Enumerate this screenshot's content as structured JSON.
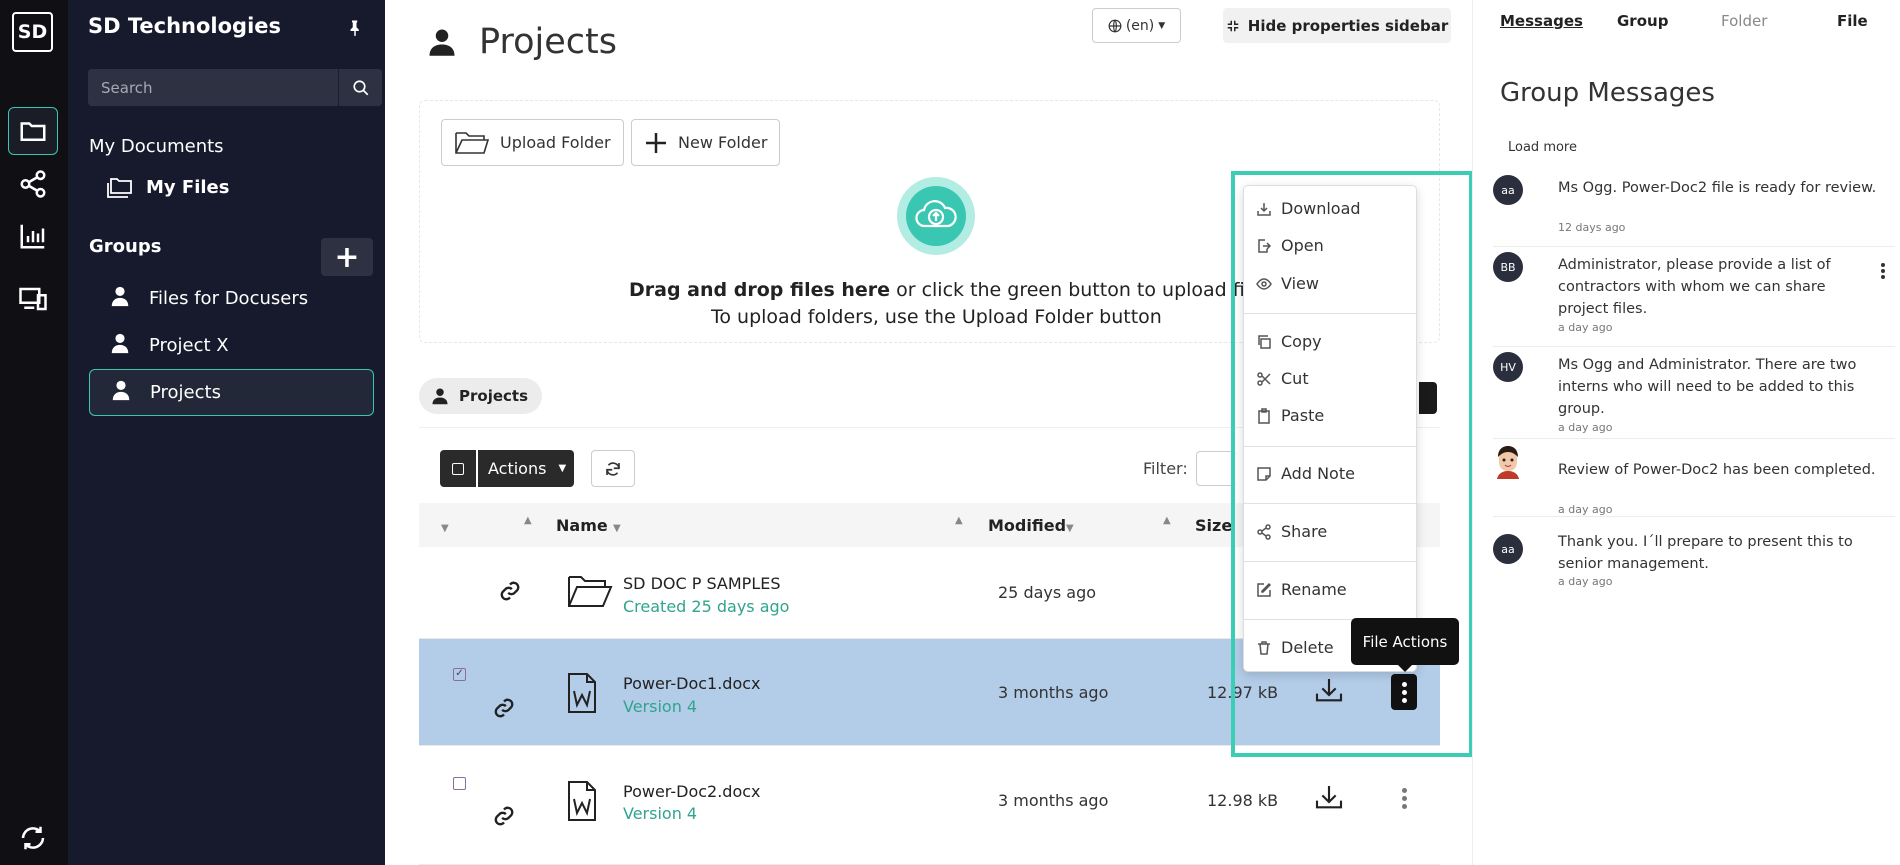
{
  "rail": {
    "logo": "SD"
  },
  "sidebar": {
    "brand": "SD Technologies",
    "search_placeholder": "Search",
    "my_documents": "My Documents",
    "my_files": "My Files",
    "groups_title": "Groups",
    "add_group": "+",
    "groups": [
      {
        "label": "Files for Docusers"
      },
      {
        "label": "Project X"
      },
      {
        "label": "Projects"
      }
    ]
  },
  "header": {
    "title": "Projects",
    "language": "(en)",
    "hide_sidebar": "Hide properties sidebar"
  },
  "upload": {
    "upload_folder": "Upload Folder",
    "new_folder": "New Folder",
    "drag_bold": "Drag and drop files here",
    "drag_rest": " or click the green button to upload files",
    "folder_hint": "To upload folders, use the Upload Folder button"
  },
  "breadcrumb": {
    "label": "Projects"
  },
  "toolbar": {
    "actions": "Actions",
    "filter_label": "Filter:"
  },
  "table": {
    "columns": {
      "name": "Name",
      "modified": "Modified",
      "size": "Size"
    },
    "rows": [
      {
        "name": "SD DOC P SAMPLES",
        "sub": "Created 25 days ago",
        "modified": "25 days ago",
        "size": "",
        "selected": false
      },
      {
        "name": "Power-Doc1.docx",
        "sub": "Version 4",
        "modified": "3 months ago",
        "size": "12.97 kB",
        "selected": true
      },
      {
        "name": "Power-Doc2.docx",
        "sub": "Version 4",
        "modified": "3 months ago",
        "size": "12.98 kB",
        "selected": false
      }
    ]
  },
  "context_menu": {
    "items": [
      {
        "label": "Download",
        "icon": "download-icon"
      },
      {
        "label": "Open",
        "icon": "open-icon"
      },
      {
        "label": "View",
        "icon": "eye-icon"
      },
      {
        "label": "Copy",
        "icon": "copy-icon"
      },
      {
        "label": "Cut",
        "icon": "scissors-icon"
      },
      {
        "label": "Paste",
        "icon": "clipboard-icon"
      },
      {
        "label": "Add Note",
        "icon": "note-icon"
      },
      {
        "label": "Share",
        "icon": "share-icon"
      },
      {
        "label": "Rename",
        "icon": "edit-icon"
      },
      {
        "label": "Delete",
        "icon": "trash-icon"
      }
    ],
    "tooltip": "File Actions"
  },
  "right_panel": {
    "tabs": [
      "Messages",
      "Group",
      "Folder",
      "File"
    ],
    "heading": "Group Messages",
    "load_more": "Load more",
    "messages": [
      {
        "avatar": "aa",
        "text": "Ms Ogg. Power-Doc2 file is ready for review.",
        "time": "12 days ago"
      },
      {
        "avatar": "BB",
        "text": "Administrator, please provide a list of contractors with whom we can share project files.",
        "time": "a day ago"
      },
      {
        "avatar": "HV",
        "text": "Ms Ogg and Administrator. There are two interns who will need to be added to this group.",
        "time": "a day ago"
      },
      {
        "avatar": "",
        "text": "Review of Power-Doc2 has been completed.",
        "time": "a day ago"
      },
      {
        "avatar": "aa",
        "text": "Thank you. I´ll prepare to present this to senior management.",
        "time": "a day ago"
      }
    ]
  },
  "colors": {
    "accent": "#39c7b2",
    "sidebar_bg": "#161a2c",
    "rail_bg": "#0f0f14",
    "selected_row": "#b3cce8"
  }
}
